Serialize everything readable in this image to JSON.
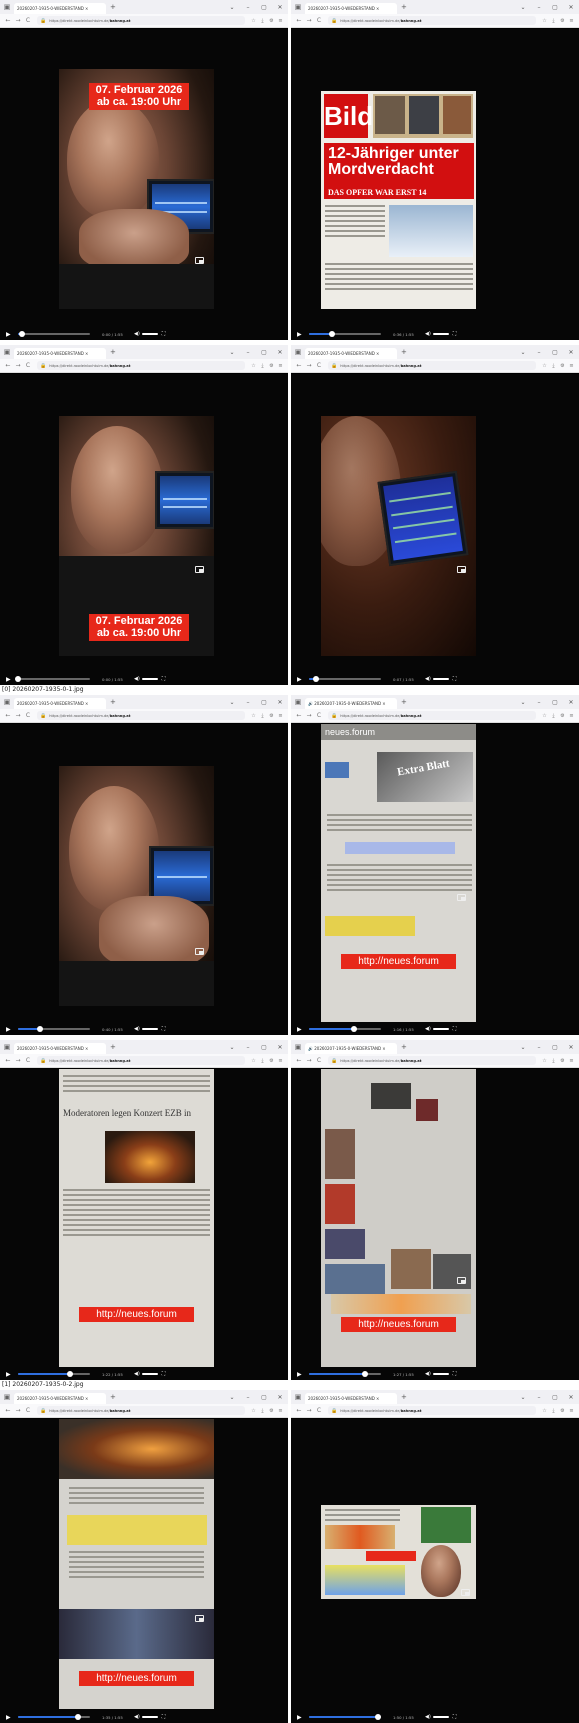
{
  "browser": {
    "tab_title": "20260207-1935-0-WIEDERSTAND ×",
    "tab_title_audio": "🔊 20260207-1935-0-WIEDERSTAND ×",
    "tab_title_short": "20260207-1935-0-WIEDERSTAND ×",
    "url_prefix": "https://direkt.roodeinlochtuim.de/",
    "url_host": "bahnng.at",
    "buttons": {
      "back": "←",
      "forward": "→",
      "reload": "C",
      "new_tab": "+",
      "minimize": "–",
      "maximize": "▢",
      "close": "✕",
      "menu": "⌄"
    }
  },
  "sheets": [
    {
      "label": "[0] 20260207-1935-0-1.jpg"
    },
    {
      "label": "[1] 20260207-1935-0-2.jpg"
    }
  ],
  "frames": [
    {
      "time": "0:00 / 1:55",
      "progress": 0.05,
      "caption_date": "07. Februar 2026",
      "caption_time": "ab ca. 19:00 Uhr"
    },
    {
      "time": "0:36 / 1:55",
      "progress": 0.32,
      "headline": "12-Jähriger unter Mordverdacht",
      "subheadline": "DAS OPFER WAR ERST 14",
      "masthead": "Bild"
    },
    {
      "time": "0:00 / 1:55",
      "progress": 0.0,
      "caption_date": "07. Februar 2026",
      "caption_time": "ab ca. 19:00 Uhr"
    },
    {
      "time": "0:07 / 1:55",
      "progress": 0.1
    },
    {
      "time": "0:40 / 1:55",
      "progress": 0.3
    },
    {
      "time": "1:16 / 1:55",
      "progress": 0.62,
      "url_caption": "http://neues.forum",
      "header_text": "neues.forum",
      "extra_blatt": "Extra Blatt"
    },
    {
      "time": "1:22 / 1:55",
      "progress": 0.72,
      "url_caption": "http://neues.forum",
      "article_headline": "Moderatoren legen Konzert EZB in"
    },
    {
      "time": "1:27 / 1:55",
      "progress": 0.78,
      "url_caption": "http://neues.forum"
    },
    {
      "time": "1:35 / 1:55",
      "progress": 0.84,
      "url_caption": "http://neues.forum"
    },
    {
      "time": "1:50 / 1:55",
      "progress": 0.96
    }
  ],
  "colors": {
    "accent": "#2f6fe0",
    "caption_red": "#e7281a",
    "bild_red": "#d20f10"
  },
  "icons": {
    "play": "▶",
    "volume": "🔈",
    "fullscreen": "⛶"
  }
}
